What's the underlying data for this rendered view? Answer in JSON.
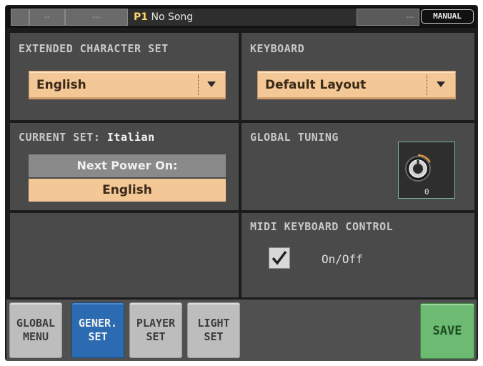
{
  "topbar": {
    "seg1": "--",
    "seg2": "---",
    "song_prefix": "P1",
    "song_title": "No Song",
    "seg3": "---",
    "mode": "MANUAL"
  },
  "extended_charset": {
    "label": "EXTENDED CHARACTER SET",
    "value": "English"
  },
  "keyboard": {
    "label": "KEYBOARD",
    "value": "Default Layout"
  },
  "current_set": {
    "label": "CURRENT SET:",
    "value": "Italian",
    "next_label": "Next Power On:",
    "next_value": "English"
  },
  "global_tuning": {
    "label": "GLOBAL TUNING",
    "value": "0"
  },
  "midi_control": {
    "label": "MIDI KEYBOARD CONTROL",
    "checkbox_label": "On/Off",
    "checked": true
  },
  "tabs": [
    {
      "line1": "GLOBAL",
      "line2": "MENU"
    },
    {
      "line1": "GENER.",
      "line2": "SET"
    },
    {
      "line1": "PLAYER",
      "line2": "SET"
    },
    {
      "line1": "LIGHT",
      "line2": "SET"
    }
  ],
  "save_label": "SAVE",
  "colors": {
    "accent_peach": "#f4c796",
    "active_tab": "#2b6bb1",
    "save_green": "#6dbb73"
  }
}
